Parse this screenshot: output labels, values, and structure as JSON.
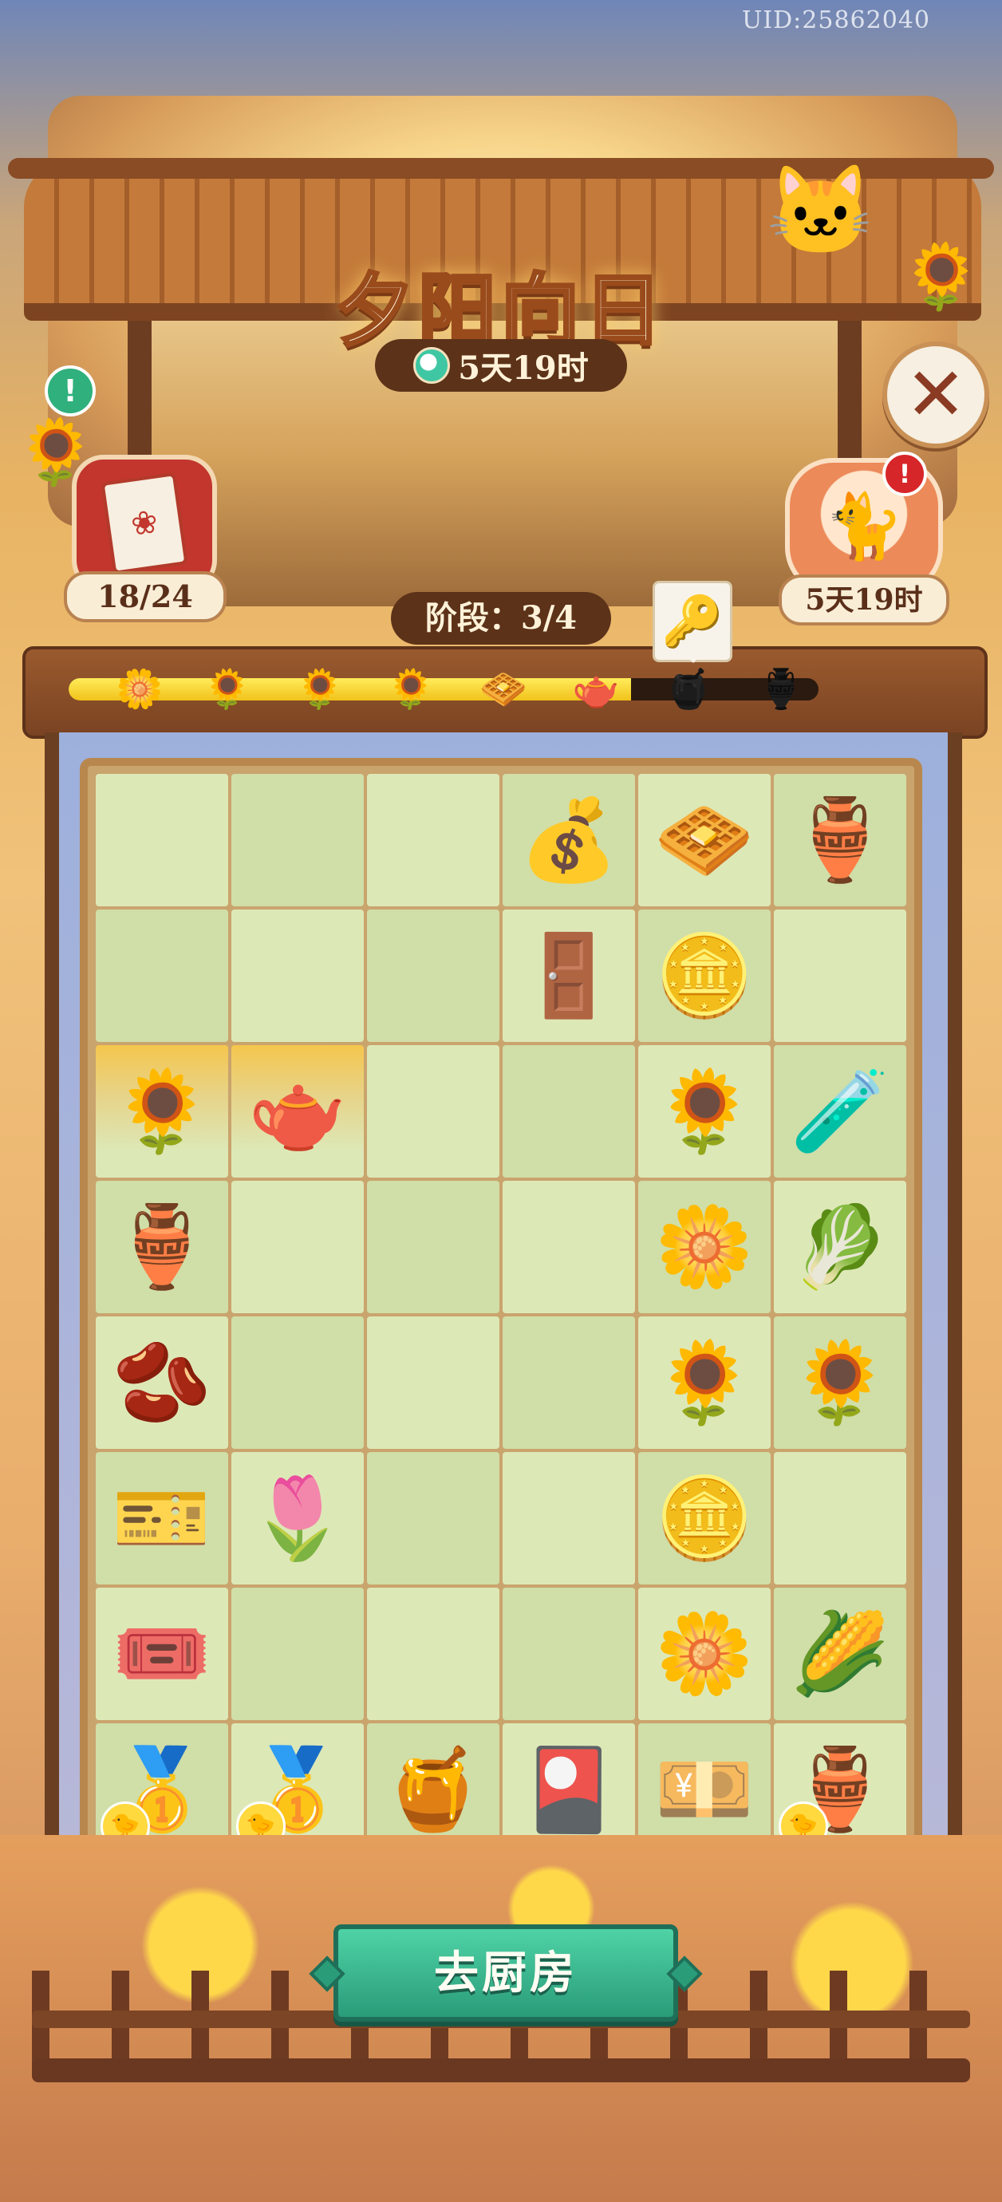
{
  "header": {
    "uid": "UID:25862040",
    "title": "夕阳向日",
    "event_timer": "5天19时"
  },
  "left_panel": {
    "card_count": "18/24"
  },
  "right_panel": {
    "event_timer": "5天19时"
  },
  "stage": {
    "label": "阶段：3/4"
  },
  "progress": {
    "fill_fraction": 0.75,
    "nodes": [
      {
        "icon": "🌼",
        "locked": false
      },
      {
        "icon": "🌻",
        "locked": false
      },
      {
        "icon": "🌻",
        "locked": false
      },
      {
        "icon": "🌻",
        "locked": false
      },
      {
        "icon": "🧇",
        "locked": false
      },
      {
        "icon": "🫖",
        "locked": false
      },
      {
        "icon": "🍯",
        "locked": true
      },
      {
        "icon": "🏺",
        "locked": true
      }
    ]
  },
  "board": {
    "cells": [
      {
        "i": "",
        "n": "empty"
      },
      {
        "i": "",
        "n": "empty"
      },
      {
        "i": "",
        "n": "empty"
      },
      {
        "i": "💰",
        "n": "energy-bag-icon"
      },
      {
        "i": "🧇",
        "n": "honeycomb-sunflower-icon"
      },
      {
        "i": "🏺",
        "n": "energy-jar-icon"
      },
      {
        "i": "",
        "n": "empty"
      },
      {
        "i": "",
        "n": "empty"
      },
      {
        "i": "",
        "n": "empty"
      },
      {
        "i": "🚪",
        "n": "locked-gate-icon"
      },
      {
        "i": "🪙",
        "n": "coin-icon"
      },
      {
        "i": "",
        "n": "empty"
      },
      {
        "i": "🌻",
        "n": "potted-sunflower-icon",
        "glow": true
      },
      {
        "i": "🫖",
        "n": "energy-teapot-icon",
        "glow": true
      },
      {
        "i": "",
        "n": "empty"
      },
      {
        "i": "",
        "n": "empty"
      },
      {
        "i": "🌻",
        "n": "sunflower-vase-icon"
      },
      {
        "i": "🧪",
        "n": "energy-bottle-icon"
      },
      {
        "i": "🏺",
        "n": "energy-urn-icon"
      },
      {
        "i": "",
        "n": "empty"
      },
      {
        "i": "",
        "n": "empty"
      },
      {
        "i": "",
        "n": "empty"
      },
      {
        "i": "🌼",
        "n": "sunflower-bouquet-icon"
      },
      {
        "i": "🥬",
        "n": "cabbage-icon"
      },
      {
        "i": "🫘",
        "n": "sunflower-seeds-icon"
      },
      {
        "i": "",
        "n": "empty"
      },
      {
        "i": "",
        "n": "empty"
      },
      {
        "i": "",
        "n": "empty"
      },
      {
        "i": "🌻",
        "n": "sunflower-brooch-icon"
      },
      {
        "i": "🌻",
        "n": "sunflower-icon"
      },
      {
        "i": "🎫",
        "n": "ticket-bundle-icon"
      },
      {
        "i": "🌷",
        "n": "red-bud-icon"
      },
      {
        "i": "",
        "n": "empty"
      },
      {
        "i": "",
        "n": "empty"
      },
      {
        "i": "🪙",
        "n": "coin-stack-icon"
      },
      {
        "i": "",
        "n": "empty"
      },
      {
        "i": "🎟️",
        "n": "ticket-icon"
      },
      {
        "i": "",
        "n": "empty"
      },
      {
        "i": "",
        "n": "empty"
      },
      {
        "i": "",
        "n": "empty"
      },
      {
        "i": "🌼",
        "n": "sunflower-sprite-icon"
      },
      {
        "i": "🌽",
        "n": "corn-sprite-icon"
      },
      {
        "i": "🥇",
        "n": "gold-bars-icon",
        "badge": "🐤"
      },
      {
        "i": "🥇",
        "n": "gold-bars-icon",
        "badge": "🐤"
      },
      {
        "i": "🍯",
        "n": "honey-jar-icon"
      },
      {
        "i": "🎴",
        "n": "recipe-card-icon"
      },
      {
        "i": "💴",
        "n": "gold-ingots-icon"
      },
      {
        "i": "🏺",
        "n": "energy-vase-icon",
        "badge": "🐤"
      }
    ]
  },
  "footer": {
    "kitchen_button": "去厨房"
  },
  "colors": {
    "accent_green": "#2a9c78",
    "wood": "#6b3f22",
    "progress_yellow": "#f1c21a"
  }
}
